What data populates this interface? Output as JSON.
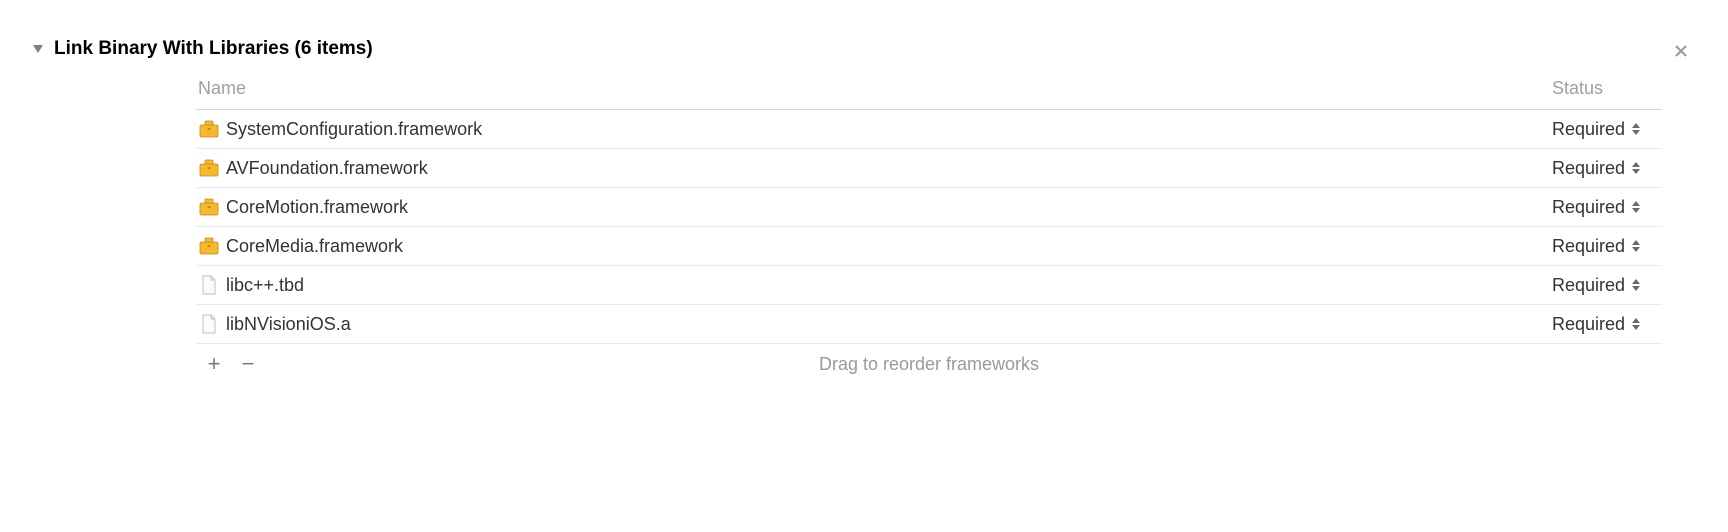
{
  "section": {
    "title": "Link Binary With Libraries (6 items)"
  },
  "columns": {
    "name": "Name",
    "status": "Status"
  },
  "rows": [
    {
      "icon": "framework",
      "name": "SystemConfiguration.framework",
      "status": "Required"
    },
    {
      "icon": "framework",
      "name": "AVFoundation.framework",
      "status": "Required"
    },
    {
      "icon": "framework",
      "name": "CoreMotion.framework",
      "status": "Required"
    },
    {
      "icon": "framework",
      "name": "CoreMedia.framework",
      "status": "Required"
    },
    {
      "icon": "file",
      "name": "libc++.tbd",
      "status": "Required"
    },
    {
      "icon": "file",
      "name": "libNVisioniOS.a",
      "status": "Required"
    }
  ],
  "footer": {
    "hint": "Drag to reorder frameworks"
  }
}
